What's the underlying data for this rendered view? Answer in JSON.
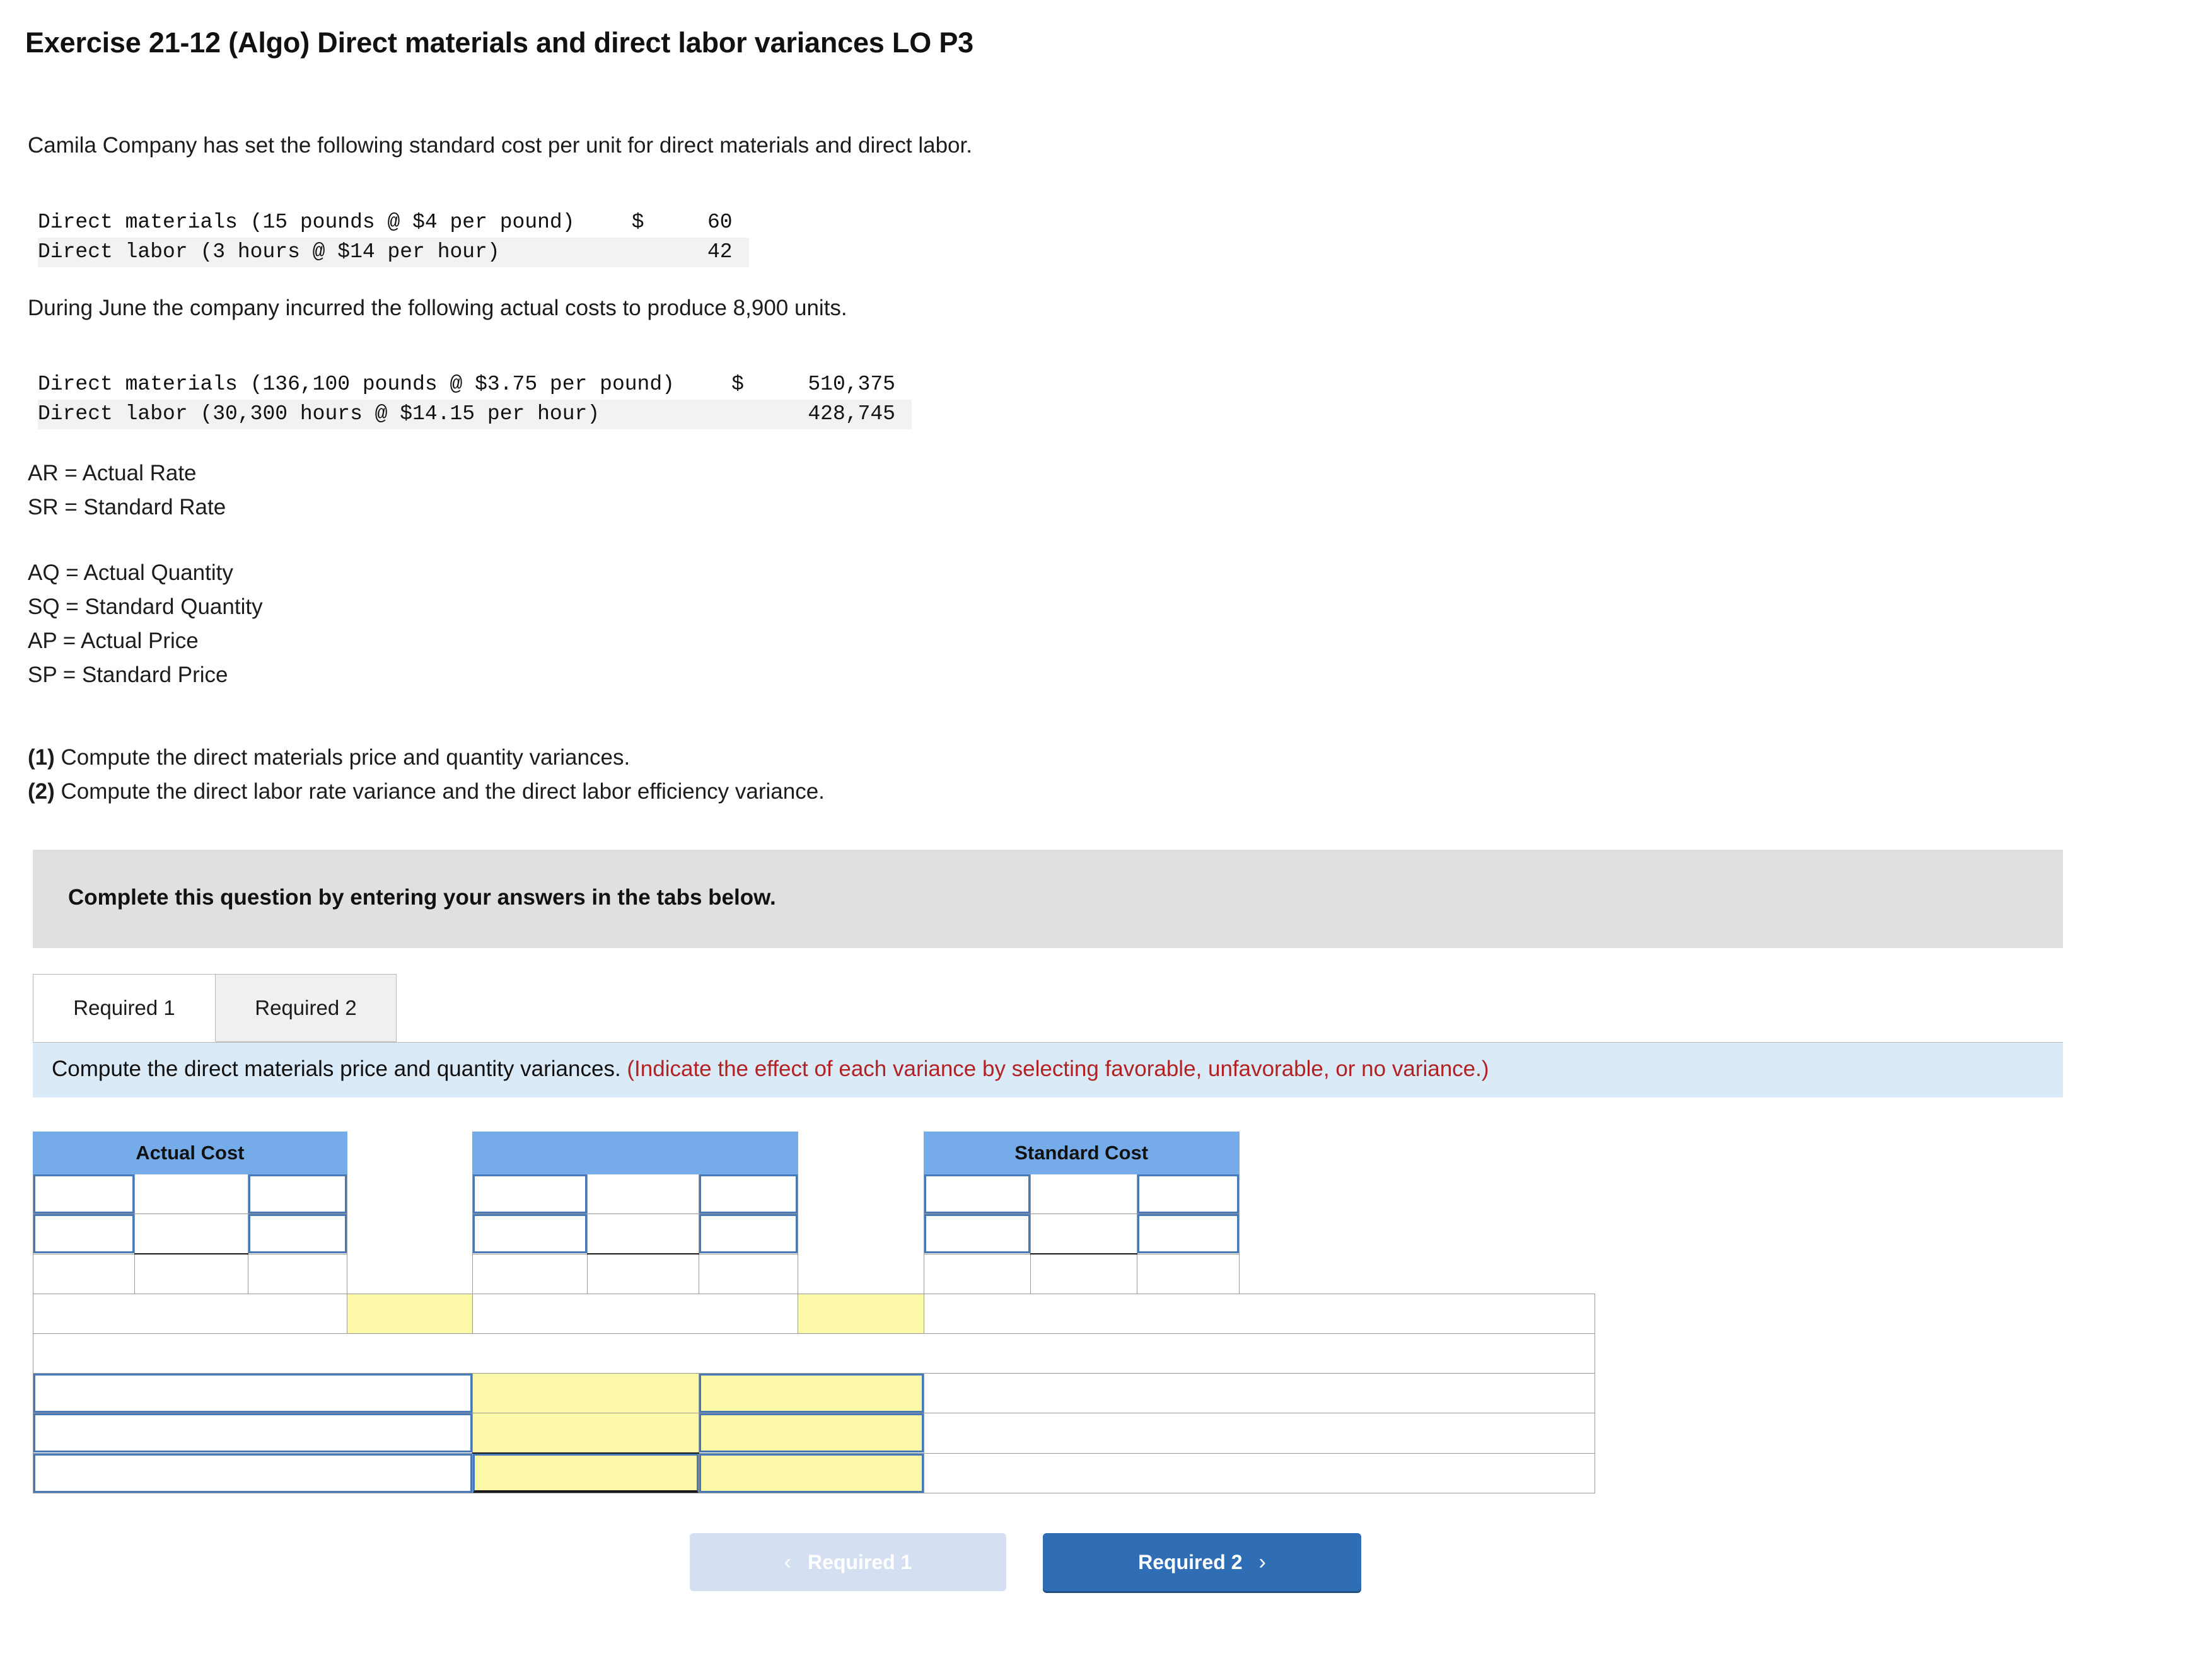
{
  "exercise": {
    "title": "Exercise 21-12 (Algo) Direct materials and direct labor variances LO P3"
  },
  "problem": {
    "intro": "Camila Company has set the following standard cost per unit for direct materials and direct labor.",
    "standard_cost_table": {
      "rows": [
        {
          "label": "Direct materials (15 pounds @ $4 per pound)",
          "currency": "$",
          "amount": "60"
        },
        {
          "label": "Direct labor (3 hours @ $14 per hour)",
          "currency": "",
          "amount": "42"
        }
      ]
    },
    "during": "During June the company incurred the following actual costs to produce 8,900 units.",
    "actual_cost_table": {
      "rows": [
        {
          "label": "Direct materials (136,100 pounds @ $3.75 per pound)",
          "currency": "$",
          "amount": "510,375"
        },
        {
          "label": "Direct labor (30,300 hours @ $14.15 per hour)",
          "currency": "",
          "amount": "428,745"
        }
      ]
    },
    "definitions_rate": [
      "AR = Actual Rate",
      "SR = Standard Rate"
    ],
    "definitions_quantity": [
      "AQ = Actual Quantity",
      "SQ = Standard Quantity",
      "AP = Actual Price",
      "SP = Standard Price"
    ],
    "requirements": [
      {
        "number": "(1)",
        "text": " Compute the direct materials price and quantity variances."
      },
      {
        "number": "(2)",
        "text": " Compute the direct labor rate variance and the direct labor efficiency variance."
      }
    ]
  },
  "banner": {
    "text": "Complete this question by entering your answers in the tabs below."
  },
  "tabs": [
    {
      "label": "Required 1",
      "active": true
    },
    {
      "label": "Required 2",
      "active": false
    }
  ],
  "instruction": {
    "black": "Compute the direct materials price and quantity variances.",
    "red": "(Indicate the effect of each variance by selecting favorable, unfavorable, or no variance.)"
  },
  "answer_grid": {
    "headers": {
      "actual_cost": "Actual Cost",
      "middle": "",
      "standard_cost": "Standard Cost"
    },
    "input_value": "",
    "input_placeholder": ""
  },
  "footer": {
    "prev_button": {
      "label": "Required 1",
      "chevron": "‹",
      "disabled": true
    },
    "next_button": {
      "label": "Required 2",
      "chevron": "›",
      "disabled": false
    }
  },
  "colors": {
    "header_blue": "#74abe8",
    "input_border_blue": "#4779b8",
    "yellow_cell": "#fbf8a8",
    "instruction_strip": "#dbeaf7",
    "banner_grey": "#e0e0e0",
    "red_text": "#b32222",
    "primary_button": "#2f6eb5",
    "disabled_button": "#d4dff1"
  }
}
